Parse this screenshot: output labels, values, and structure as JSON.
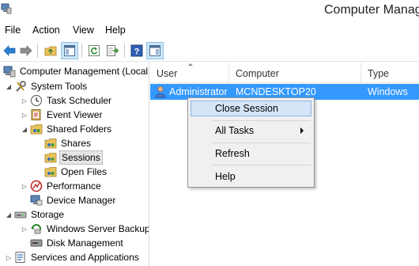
{
  "window": {
    "title": "Computer Manage"
  },
  "menu": [
    "File",
    "Action",
    "View",
    "Help"
  ],
  "tree": {
    "root": "Computer Management (Local",
    "system_tools": "System Tools",
    "task_scheduler": "Task Scheduler",
    "event_viewer": "Event Viewer",
    "shared_folders": "Shared Folders",
    "shares": "Shares",
    "sessions": "Sessions",
    "open_files": "Open Files",
    "performance": "Performance",
    "device_manager": "Device Manager",
    "storage": "Storage",
    "windows_server_backup": "Windows Server Backup",
    "disk_management": "Disk Management",
    "services_apps": "Services and Applications"
  },
  "list": {
    "columns": [
      "User",
      "Computer",
      "Type"
    ],
    "rows": [
      {
        "user": "Administrator",
        "computer": "MCNDESKTOP20",
        "type": "Windows"
      }
    ]
  },
  "context_menu": {
    "items": [
      "Close Session",
      "All Tasks",
      "Refresh",
      "Help"
    ]
  },
  "colors": {
    "selection": "#3399ff",
    "menu_hover": "#d5e5f7",
    "menu_bg": "#f0f0f0"
  },
  "icons": [
    "computer-management-icon",
    "back-arrow-icon",
    "forward-arrow-icon",
    "up-folder-icon",
    "show-hide-tree-icon",
    "refresh-icon",
    "export-list-icon",
    "help-icon",
    "action-pane-icon"
  ]
}
